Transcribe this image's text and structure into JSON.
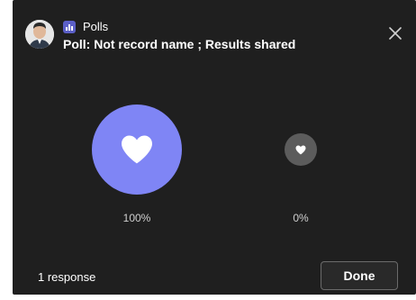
{
  "header": {
    "app_name": "Polls",
    "poll_title": "Poll: Not record name ; Results shared"
  },
  "options": [
    {
      "percent_label": "100%",
      "percent_value": 100,
      "icon": "heart-icon",
      "color": "#7f85f5"
    },
    {
      "percent_label": "0%",
      "percent_value": 0,
      "icon": "heart-icon",
      "color": "#5c5c5c"
    }
  ],
  "footer": {
    "response_count": "1 response",
    "done_label": "Done"
  },
  "colors": {
    "background": "#1f1f1f",
    "accent": "#5b5fc7"
  }
}
